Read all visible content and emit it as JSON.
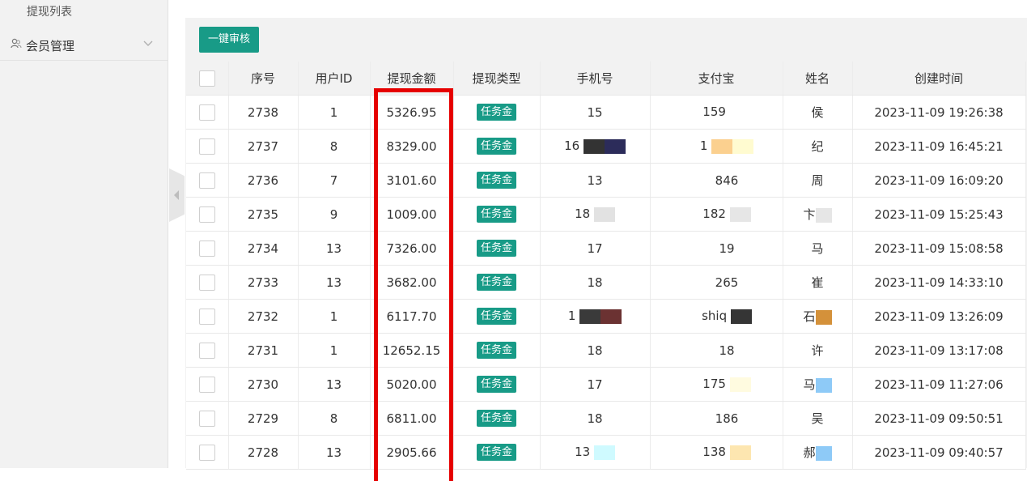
{
  "sidebar": {
    "sub_item": "提现列表",
    "member_menu": {
      "label": "会员管理",
      "icon": "users-icon",
      "chevron": "chevron-down-icon"
    }
  },
  "toolbar": {
    "audit_label": "一键审核"
  },
  "table": {
    "headers": [
      "序号",
      "用户ID",
      "提现金额",
      "提现类型",
      "手机号",
      "支付宝",
      "姓名",
      "创建时间"
    ],
    "rows": [
      {
        "id": "2738",
        "user": "1",
        "amount": "5326.95",
        "type": "任务金",
        "phone": "15",
        "alipay": "159",
        "name": "侯",
        "time": "2023-11-09 19:26:38"
      },
      {
        "id": "2737",
        "user": "8",
        "amount": "8329.00",
        "type": "任务金",
        "phone": "16",
        "alipay": "1",
        "name": "纪",
        "time": "2023-11-09 16:45:21"
      },
      {
        "id": "2736",
        "user": "7",
        "amount": "3101.60",
        "type": "任务金",
        "phone": "13",
        "alipay": "846",
        "name": "周",
        "time": "2023-11-09 16:09:20"
      },
      {
        "id": "2735",
        "user": "9",
        "amount": "1009.00",
        "type": "任务金",
        "phone": "18",
        "alipay": "182",
        "name": "卞",
        "time": "2023-11-09 15:25:43"
      },
      {
        "id": "2734",
        "user": "13",
        "amount": "7326.00",
        "type": "任务金",
        "phone": "17",
        "alipay": "19",
        "name": "马",
        "time": "2023-11-09 15:08:58"
      },
      {
        "id": "2733",
        "user": "13",
        "amount": "3682.00",
        "type": "任务金",
        "phone": "18",
        "alipay": "265",
        "name": "崔",
        "time": "2023-11-09 14:33:10"
      },
      {
        "id": "2732",
        "user": "1",
        "amount": "6117.70",
        "type": "任务金",
        "phone": "1",
        "alipay": "shiq",
        "name": "石",
        "time": "2023-11-09 13:26:09"
      },
      {
        "id": "2731",
        "user": "1",
        "amount": "12652.15",
        "type": "任务金",
        "phone": "18",
        "alipay": "18",
        "name": "许",
        "time": "2023-11-09 13:17:08"
      },
      {
        "id": "2730",
        "user": "13",
        "amount": "5020.00",
        "type": "任务金",
        "phone": "17",
        "alipay": "175",
        "name": "马",
        "time": "2023-11-09 11:27:06"
      },
      {
        "id": "2729",
        "user": "8",
        "amount": "6811.00",
        "type": "任务金",
        "phone": "18",
        "alipay": "186",
        "name": "吴",
        "time": "2023-11-09 09:50:51"
      },
      {
        "id": "2728",
        "user": "13",
        "amount": "2905.66",
        "type": "任务金",
        "phone": "13",
        "alipay": "138",
        "name": "郝",
        "time": "2023-11-09 09:40:57"
      }
    ]
  },
  "colors": {
    "accent": "#189b87",
    "highlight": "#e60000"
  }
}
